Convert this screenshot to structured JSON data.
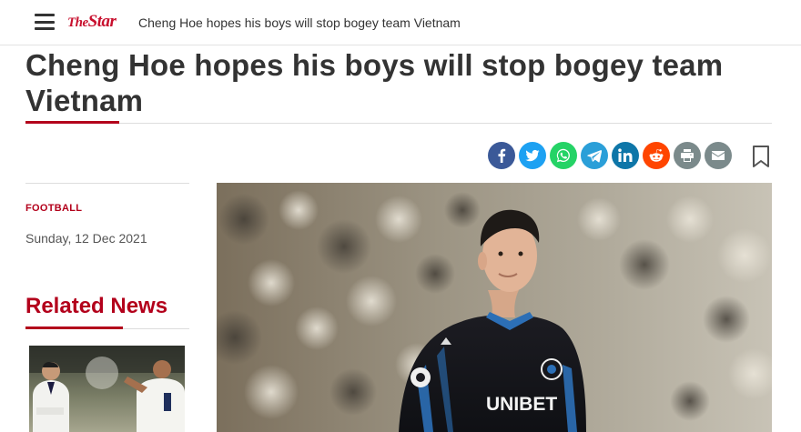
{
  "topbar": {
    "logo_prefix": "The",
    "logo_main": "Star",
    "title": "Cheng Hoe hopes his boys will stop bogey team Vietnam"
  },
  "article": {
    "headline": "Cheng Hoe hopes his boys will stop bogey team Vietnam",
    "category": "FOOTBALL",
    "date": "Sunday, 12 Dec 2021",
    "image_jersey_text": "UNIBET"
  },
  "share": [
    {
      "name": "facebook",
      "icon": "facebook-icon",
      "color": "#3b5998"
    },
    {
      "name": "twitter",
      "icon": "twitter-icon",
      "color": "#1da1f2"
    },
    {
      "name": "whatsapp",
      "icon": "whatsapp-icon",
      "color": "#25d366"
    },
    {
      "name": "telegram",
      "icon": "telegram-icon",
      "color": "#2b9fd8"
    },
    {
      "name": "linkedin",
      "icon": "linkedin-icon",
      "color": "#0e76a8"
    },
    {
      "name": "reddit",
      "icon": "reddit-icon",
      "color": "#ff4500"
    },
    {
      "name": "print",
      "icon": "print-icon",
      "color": "#7b8a8b"
    },
    {
      "name": "email",
      "icon": "email-icon",
      "color": "#7b8a8b"
    }
  ],
  "related": {
    "title": "Related News"
  },
  "colors": {
    "accent": "#b3001b",
    "brand": "#c8102e"
  }
}
